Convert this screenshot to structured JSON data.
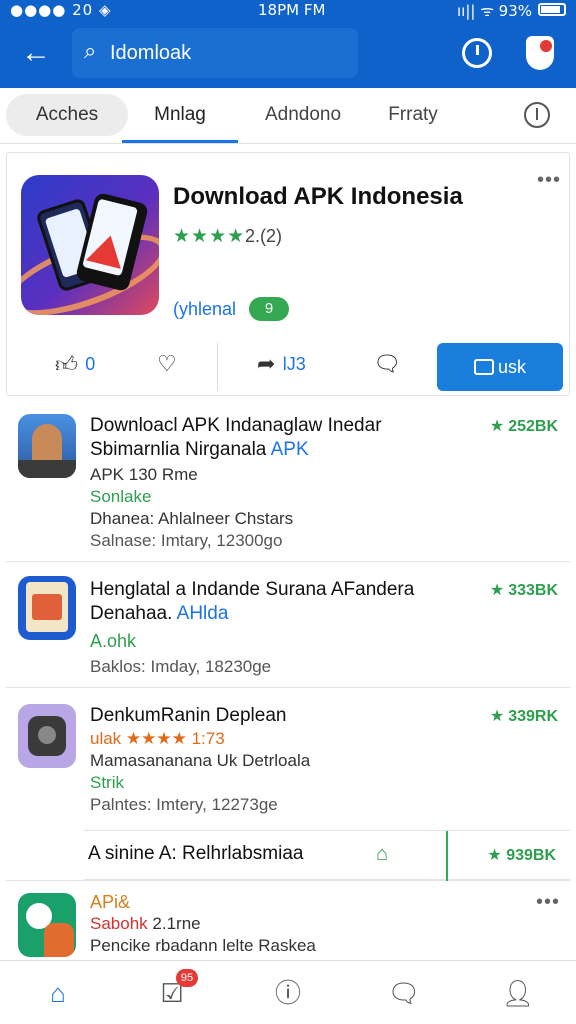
{
  "status": {
    "left": "●●●● 20 ◈ ",
    "time": "18PM FM",
    "right": "ıı|| ᯤ 93%"
  },
  "search": {
    "value": "Idomloak"
  },
  "tabs": [
    {
      "label": "Acches"
    },
    {
      "label": "Mnlag"
    },
    {
      "label": "Adndono"
    },
    {
      "label": "Frraty"
    }
  ],
  "featured": {
    "title": "Download APK Indonesia",
    "stars": "★★★★",
    "rating": "2.(2)",
    "developer": "(yhlenal",
    "badge": "9",
    "actions": {
      "like_count": "0",
      "share_count": "lJ3"
    },
    "primary_label": "usk"
  },
  "list": [
    {
      "title": "Downloacl APK Indanaglaw Inedar Sbimarnlia Nirganala",
      "title_tag": "APK",
      "line1": "APK 130 Rme",
      "line2": "Sonlake",
      "line3": "Dhanea: Ahlalneer Chstars",
      "line4": "Salnase: Imtary, 12300go",
      "size": "252BK"
    },
    {
      "title": "Henglatal a Indande Surana AFandera",
      "title2": "Denahaa.",
      "title_tag": "AHlda",
      "line1": "A.ohk",
      "line2": "Baklos: Imday, 18230ge",
      "size": "333BK"
    },
    {
      "title": "DenkumRanin Deplean",
      "line1_prefix": "ulak",
      "line1": "★★★★ 1:73",
      "line2": "Mamasananana Uk Detrloala",
      "line3": "Strik",
      "line4": "Palntes: Imtery, 12273ge",
      "size": "339RK"
    },
    {
      "title": "APi&",
      "line1": "Sabohk",
      "line1b": "2.1rne",
      "line2": "Pencike rbadann lelte Raskea"
    }
  ],
  "sub_row": {
    "label": "A sinine A: Relhrlabsmiaa",
    "size": "939BK"
  },
  "colors": {
    "brand": "#0f62c9",
    "accent": "#1a73e8",
    "green": "#2e9e4f"
  },
  "nav": {
    "badge": "95"
  }
}
